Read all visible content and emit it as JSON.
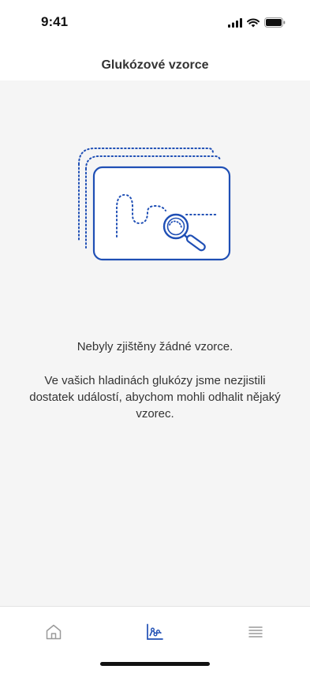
{
  "status_bar": {
    "time": "9:41",
    "icons": [
      "cellular-signal-icon",
      "wifi-icon",
      "battery-icon"
    ]
  },
  "header": {
    "title": "Glukózové vzorce"
  },
  "empty_state": {
    "illustration": "pattern-search-illustration",
    "title": "Nebyly zjištěny žádné vzorce.",
    "description": "Ve vašich hladinách glukózy jsme nezjistili dostatek událostí, abychom mohli odhalit nějaký vzorec."
  },
  "tab_bar": {
    "items": [
      {
        "icon": "home-icon",
        "active": false
      },
      {
        "icon": "chart-icon",
        "active": true
      },
      {
        "icon": "menu-icon",
        "active": false
      }
    ],
    "colors": {
      "active": "#1f4fb5",
      "inactive": "#9a9a9a"
    }
  },
  "colors": {
    "accent": "#1f4fb5",
    "background": "#f5f5f5"
  }
}
